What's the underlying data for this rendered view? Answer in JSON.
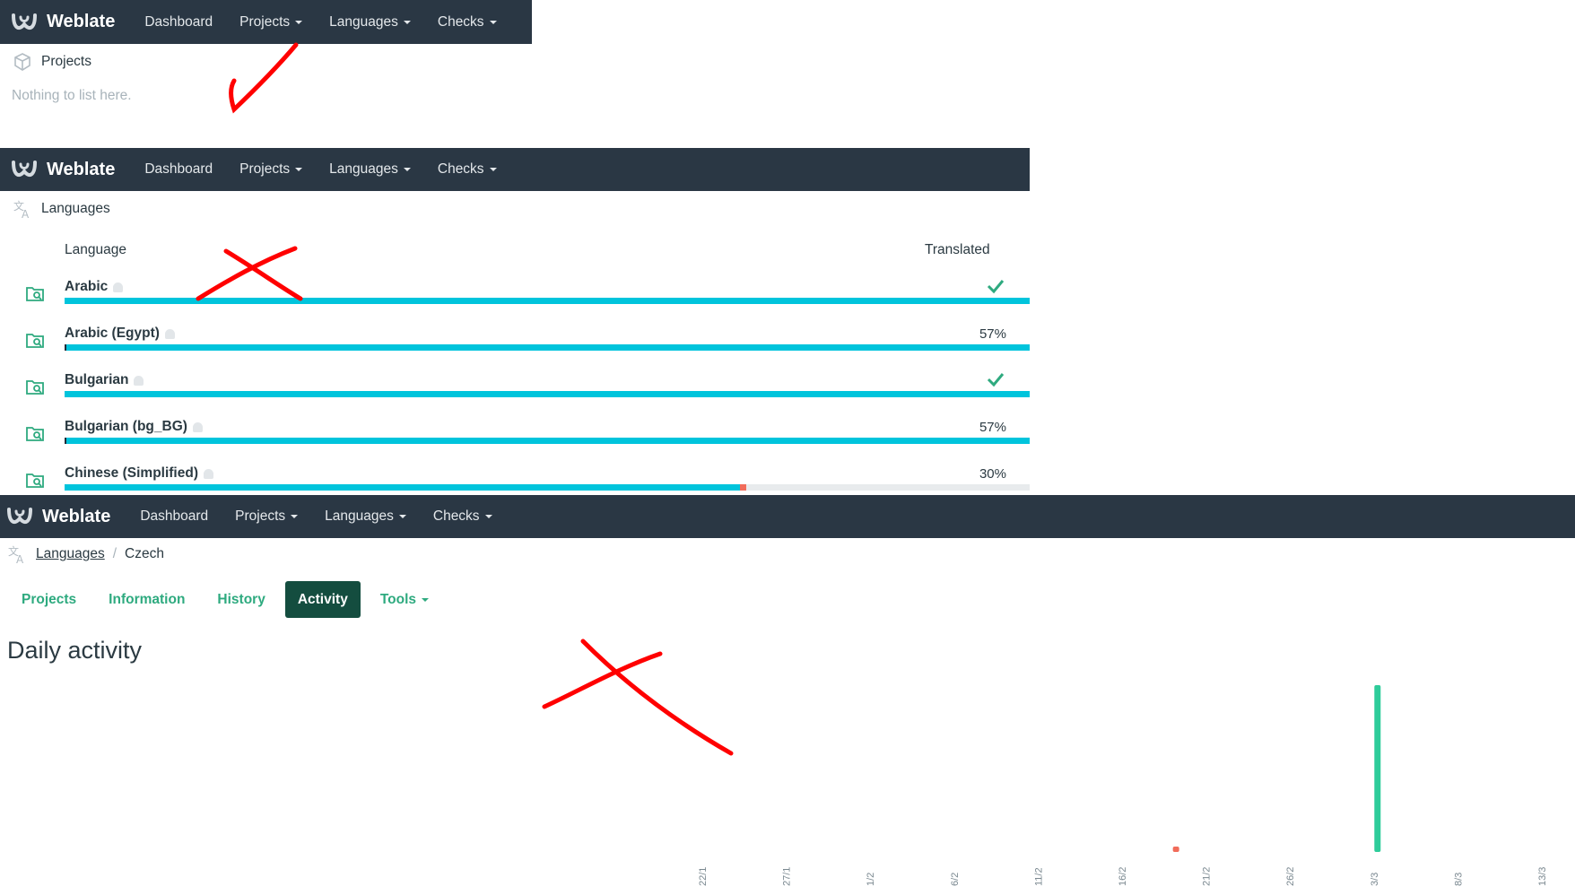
{
  "nav": {
    "brand": "Weblate",
    "items": [
      "Dashboard",
      "Projects",
      "Languages",
      "Checks"
    ]
  },
  "panel1": {
    "title": "Projects",
    "empty": "Nothing to list here."
  },
  "panel2": {
    "title": "Languages",
    "col_language": "Language",
    "col_translated": "Translated",
    "rows": [
      {
        "name": "Arabic",
        "translated": "",
        "complete": true,
        "fill": 1.0,
        "failing": 0
      },
      {
        "name": "Arabic (Egypt)",
        "translated": "57%",
        "complete": false,
        "fill": 1.0,
        "failing": 0
      },
      {
        "name": "Bulgarian",
        "translated": "",
        "complete": true,
        "fill": 1.0,
        "failing": 0
      },
      {
        "name": "Bulgarian (bg_BG)",
        "translated": "57%",
        "complete": false,
        "fill": 1.0,
        "failing": 0
      },
      {
        "name": "Chinese (Simplified)",
        "translated": "30%",
        "complete": false,
        "fill": 0.7,
        "failing": 0.006
      }
    ]
  },
  "panel3": {
    "breadcrumb_link": "Languages",
    "breadcrumb_current": "Czech",
    "tabs": [
      "Projects",
      "Information",
      "History",
      "Activity",
      "Tools"
    ],
    "active_tab": "Activity",
    "heading": "Daily activity"
  },
  "colors": {
    "navbar": "#2a3744",
    "accent": "#2eaa7f",
    "active_tab": "#144d3f",
    "progress": "#00c4dc",
    "failing": "#f16c5a",
    "annotation": "#ff0000"
  },
  "chart_data": {
    "type": "bar",
    "title": "",
    "xlabel": "",
    "ylabel": "",
    "ylim": [
      0,
      1
    ],
    "x_ticks": [
      "22/1",
      "27/1",
      "1/2",
      "6/2",
      "11/2",
      "16/2",
      "21/2",
      "26/2",
      "3/3",
      "8/3",
      "13/3"
    ],
    "x_start_day": "22/1",
    "series": [
      {
        "name": "",
        "color": "#2ecc9a",
        "points": [
          {
            "x": "3/3",
            "y": 1.0
          }
        ]
      },
      {
        "name": "",
        "color": "#f16c5a",
        "points": [
          {
            "x": "19/2",
            "y": 0.02
          }
        ]
      }
    ]
  }
}
